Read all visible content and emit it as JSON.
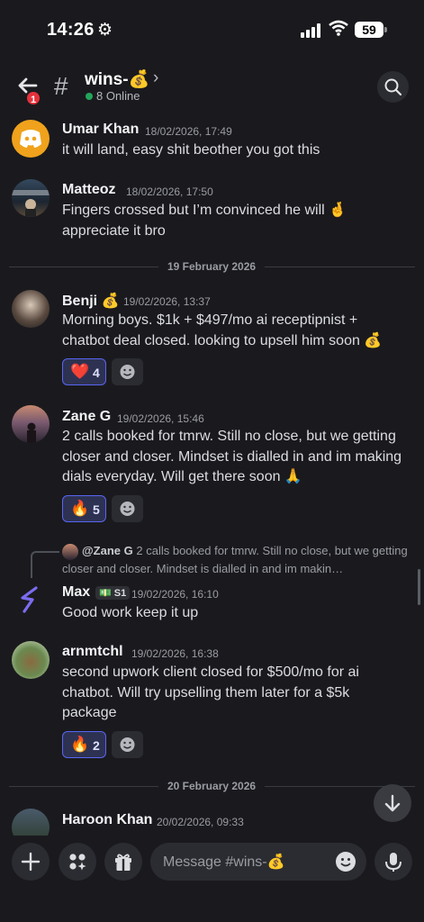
{
  "status_bar": {
    "time": "14:26",
    "battery": "59"
  },
  "header": {
    "channel_name": "wins-💰",
    "online": "8 Online",
    "unread_badge": "1"
  },
  "messages": [
    {
      "author": "Umar Khan",
      "timestamp": "18/02/2026, 17:49",
      "text": "it will land, easy shit beother you got this"
    },
    {
      "author": "Matteoz",
      "timestamp": "18/02/2026, 17:50",
      "text": "Fingers crossed but I’m convinced he will 🤞 appreciate it bro"
    },
    {
      "author": "Benji 💰",
      "timestamp": "19/02/2026, 13:37",
      "text": "Morning boys. $1k + $497/mo ai receptipnist + chatbot deal closed. looking to upsell him soon 💰",
      "reaction": {
        "emoji": "❤️",
        "count": "4"
      }
    },
    {
      "author": "Zane G",
      "timestamp": "19/02/2026, 15:46",
      "text": "2 calls booked for tmrw. Still no close, but we getting closer and closer. Mindset is dialled in and im making dials everyday. Will get there soon 🙏",
      "reaction": {
        "emoji": "🔥",
        "count": "5"
      }
    },
    {
      "author": "Max",
      "tag": "💵 S1",
      "timestamp": "19/02/2026, 16:10",
      "text": "Good work keep it up",
      "reply_to": "@Zane G",
      "reply_preview": "2 calls booked for tmrw. Still no close, but we getting closer and closer. Mindset is dialled in and im makin…"
    },
    {
      "author": "arnmtchl",
      "timestamp": "19/02/2026, 16:38",
      "text": "second upwork client closed for $500/mo for ai chatbot. Will try upselling them later for a $5k package",
      "reaction": {
        "emoji": "🔥",
        "count": "2"
      }
    },
    {
      "author": "Haroon Khan",
      "timestamp": "20/02/2026, 09:33"
    }
  ],
  "dividers": {
    "d1": "19 February 2026",
    "d2": "20 February 2026"
  },
  "composer": {
    "placeholder": "Message #wins-💰"
  },
  "colors": {
    "accent": "#5865f2",
    "online": "#23a55a",
    "badge": "#e6313c"
  }
}
